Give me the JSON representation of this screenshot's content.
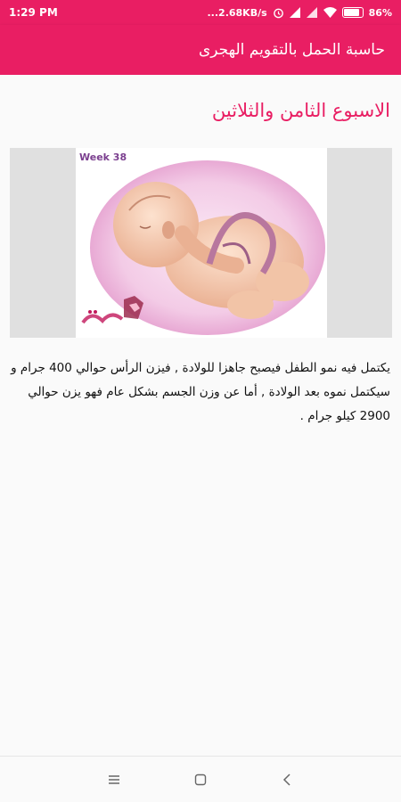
{
  "status_bar": {
    "time": "1:29 PM",
    "net_speed": "...2.68KB/s",
    "battery_percent": "86%",
    "battery_level": 0.86,
    "icons": [
      "alarm-icon",
      "signal-icon",
      "signal-icon",
      "wifi-icon",
      "battery-icon"
    ]
  },
  "app_bar": {
    "title": "حاسبة الحمل بالتقويم الهجرى"
  },
  "main": {
    "week_title": "الاسبوع الثامن والثلاثين",
    "image": {
      "week_label": "Week 38",
      "watermark_text": "رقيقة"
    },
    "description": "يكتمل فيه نمو الطفل فيصبح جاهزا للولادة , فيزن الرأس حوالي 400 جرام و سيكتمل نموه بعد الولادة , أما عن وزن الجسم بشكل عام فهو يزن حوالي 2900 كيلو جرام ."
  },
  "nav_bar": {
    "buttons": [
      "menu-icon",
      "home-icon",
      "back-icon"
    ]
  },
  "colors": {
    "accent": "#e91e63",
    "image_frame": "#e0e0e0",
    "background": "#fafafa"
  }
}
